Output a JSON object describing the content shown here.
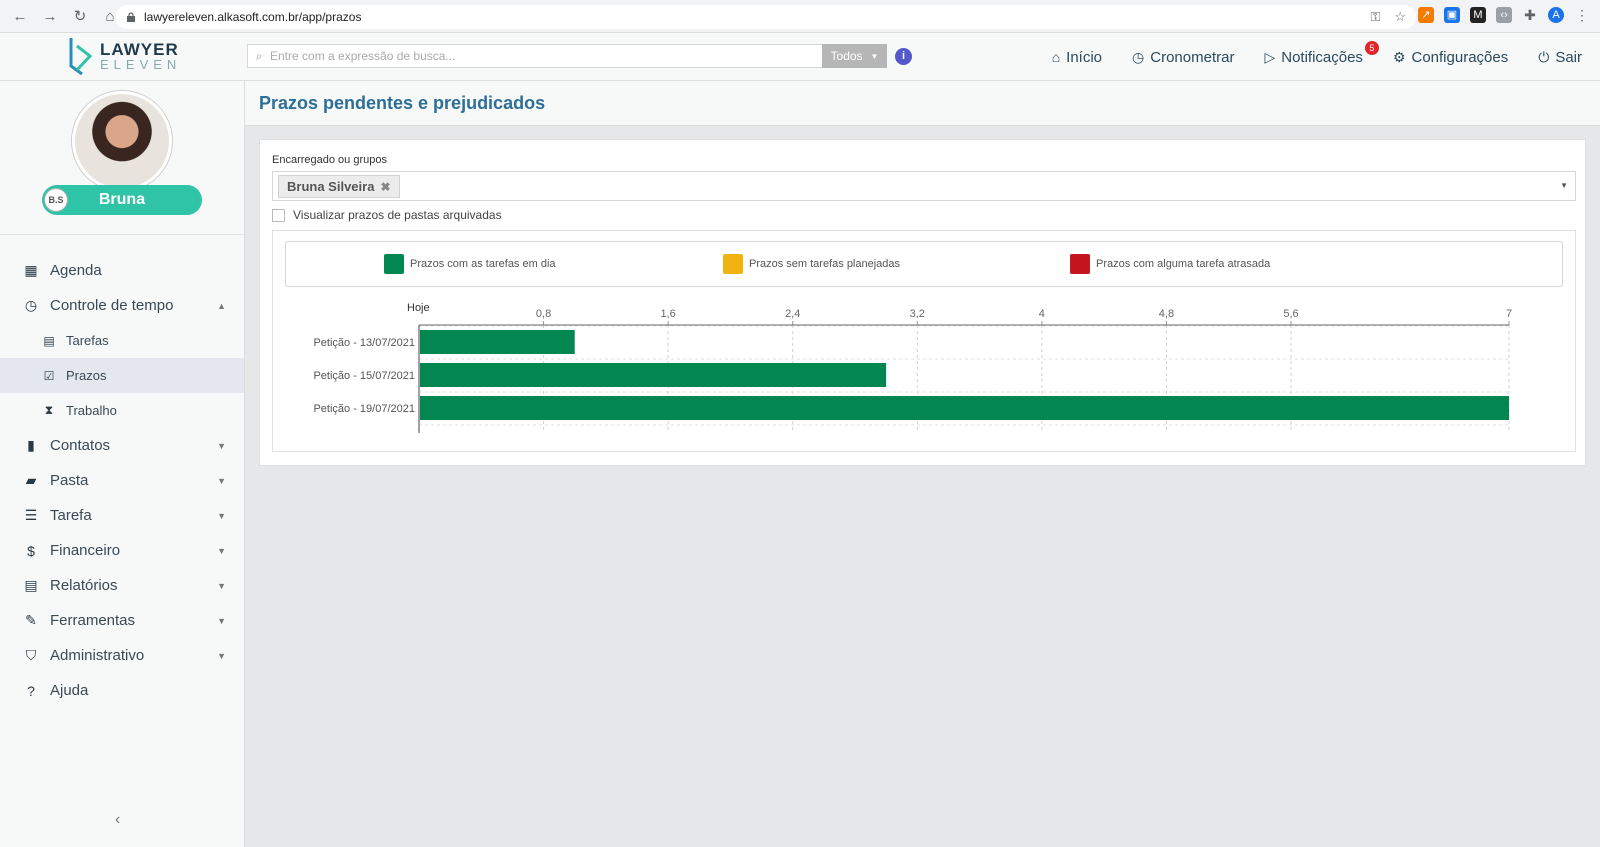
{
  "browser": {
    "url": "lawyereleven.alkasoft.com.br/app/prazos",
    "profile_initial": "A"
  },
  "header": {
    "logo_line1": "LAWYER",
    "logo_line2": "ELEVEN",
    "search_placeholder": "Entre com a expressão de busca...",
    "search_scope": "Todos",
    "nav": {
      "inicio": "Início",
      "cronometrar": "Cronometrar",
      "notificacoes": "Notificações",
      "notificacoes_count": "5",
      "configuracoes": "Configurações",
      "sair": "Sair"
    }
  },
  "sidebar": {
    "user_name": "Bruna",
    "user_initials": "B.S",
    "items": {
      "agenda": "Agenda",
      "controle": "Controle de tempo",
      "tarefas": "Tarefas",
      "prazos": "Prazos",
      "trabalho": "Trabalho",
      "contatos": "Contatos",
      "pasta": "Pasta",
      "tarefa": "Tarefa",
      "financeiro": "Financeiro",
      "relatorios": "Relatórios",
      "ferramentas": "Ferramentas",
      "administrativo": "Administrativo",
      "ajuda": "Ajuda"
    }
  },
  "page": {
    "title": "Prazos pendentes e prejudicados",
    "assignee_label": "Encarregado ou grupos",
    "assignee_tag": "Bruna Silveira",
    "archived_checkbox_label": "Visualizar prazos de pastas arquivadas"
  },
  "colors": {
    "on_time": "#038751",
    "no_tasks": "#f0b30f",
    "late": "#c5161d",
    "accent": "#2d6f96",
    "profile_pill": "#2fc4a7"
  },
  "chart_data": {
    "type": "bar",
    "orientation": "horizontal",
    "legend": [
      "Prazos com as tarefas em dia",
      "Prazos sem tarefas planejadas",
      "Prazos com alguma tarefa atrasada"
    ],
    "origin_label": "Hoje",
    "categories": [
      "Petição - 13/07/2021",
      "Petição - 15/07/2021",
      "Petição - 19/07/2021"
    ],
    "series": [
      {
        "name": "Prazos com as tarefas em dia",
        "values": [
          1,
          3,
          7
        ]
      }
    ],
    "xticks": [
      "0,8",
      "1,6",
      "2,4",
      "3,2",
      "4",
      "4,8",
      "5,6",
      "7"
    ],
    "xtick_values": [
      0.8,
      1.6,
      2.4,
      3.2,
      4,
      4.8,
      5.6,
      7
    ],
    "xlim": [
      0,
      7
    ],
    "grid": true,
    "legend_position": "top"
  }
}
